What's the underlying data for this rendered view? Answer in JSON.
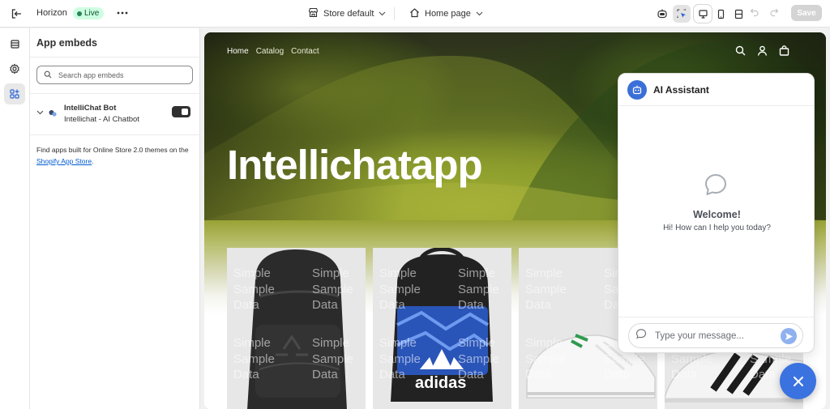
{
  "topbar": {
    "theme_name": "Horizon",
    "live_badge": "Live",
    "store_selector": "Store default",
    "page_selector": "Home page",
    "save_label": "Save"
  },
  "rail": {
    "items": [
      {
        "icon": "sections-icon"
      },
      {
        "icon": "gear-icon"
      },
      {
        "icon": "app-embeds-icon",
        "active": true
      }
    ]
  },
  "panel": {
    "title": "App embeds",
    "search_placeholder": "Search app embeds",
    "embeds": [
      {
        "name": "IntelliChat Bot",
        "subtitle": "Intellichat - AI Chatbot",
        "enabled": true
      }
    ],
    "help_text": "Find apps built for Online Store 2.0 themes on the ",
    "help_link": "Shopify App Store",
    "help_suffix": "."
  },
  "preview": {
    "nav": [
      "Home",
      "Catalog",
      "Contact"
    ],
    "hero_title": "Intellichatapp",
    "watermark": "Simple\nSample\nData",
    "products": [
      {
        "name": "black-backpack"
      },
      {
        "name": "blue-adidas-backpack"
      },
      {
        "name": "white-sneaker-green"
      },
      {
        "name": "white-sneaker-black"
      }
    ]
  },
  "chat": {
    "title": "AI Assistant",
    "welcome": "Welcome!",
    "subtitle": "Hi! How can I help you today?",
    "input_placeholder": "Type your message..."
  },
  "colors": {
    "accent": "#3a72e0",
    "live_bg": "#cdfee1",
    "link": "#005bd3"
  }
}
